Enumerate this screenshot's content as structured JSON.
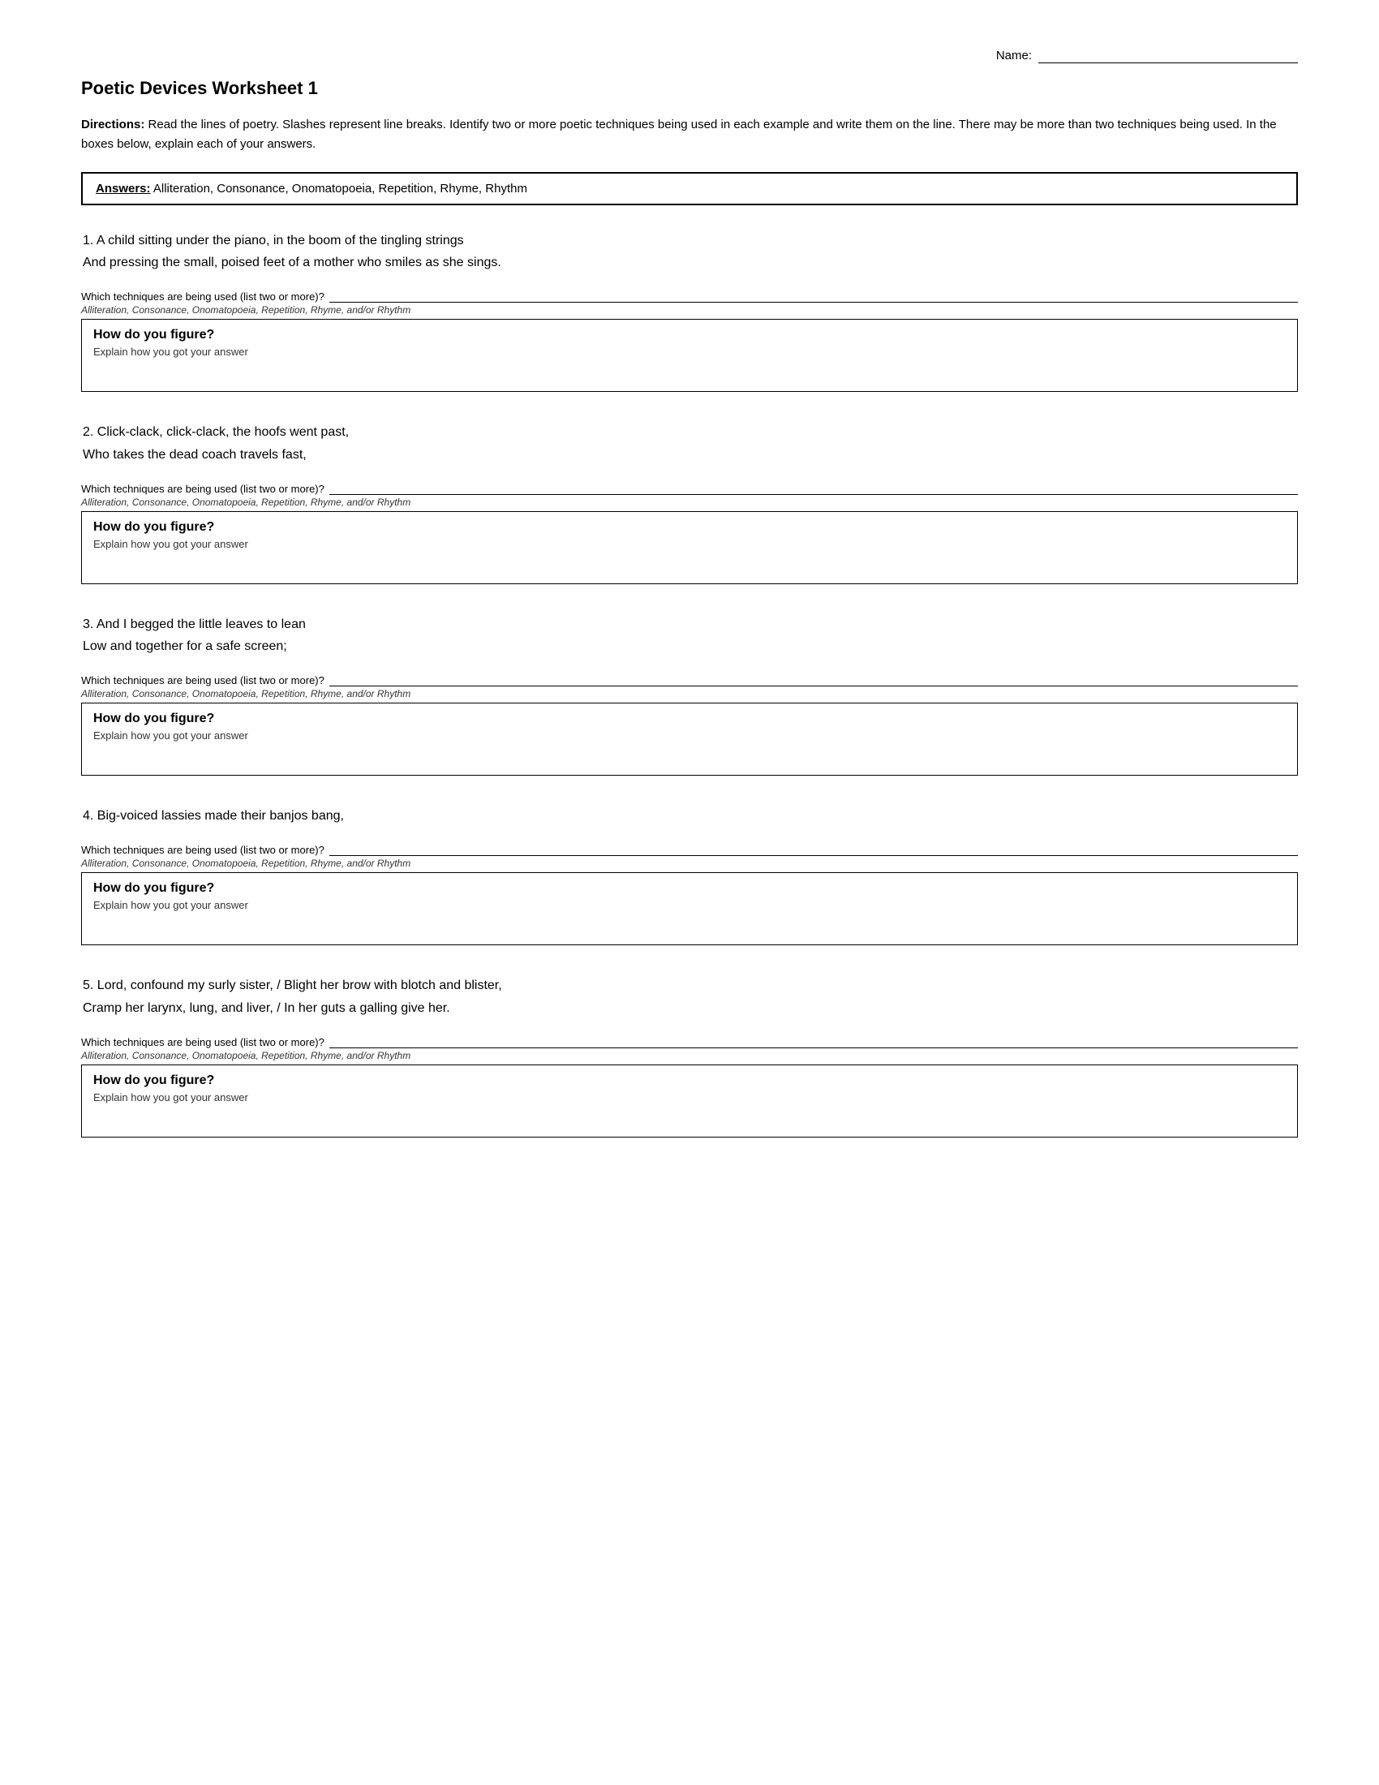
{
  "page": {
    "name_label": "Name:",
    "title": "Poetic Devices Worksheet 1",
    "directions_bold": "Directions:",
    "directions_text": " Read the lines of poetry. Slashes represent line breaks. Identify two or more poetic techniques being used in each example and write them on the line. There may be more than two techniques being used. In the boxes below, explain each of your answers.",
    "answers_bold": "Answers:",
    "answers_text": " Alliteration, Consonance, Onomatopoeia, Repetition, Rhyme, Rhythm",
    "which_techniques_label": "Which techniques are being used (list two or more)?",
    "hint_text": "Alliteration, Consonance, Onomatopoeia, Repetition, Rhyme, and/or Rhythm",
    "figure_title": "How do you figure?",
    "figure_subtitle": "Explain how you got your answer",
    "questions": [
      {
        "number": "1.",
        "poem": "A child sitting under the piano, in the boom of the tingling strings\nAnd pressing the small, poised feet of a mother who smiles as she sings."
      },
      {
        "number": "2.",
        "poem": "Click-clack, click-clack, the hoofs went past,\nWho takes the dead coach travels fast,"
      },
      {
        "number": "3.",
        "poem": "And I begged the little leaves to lean\nLow and together for a safe screen;"
      },
      {
        "number": "4.",
        "poem": "Big-voiced lassies made their banjos bang,"
      },
      {
        "number": "5.",
        "poem": "Lord, confound my surly sister, / Blight her brow with blotch and blister,\n Cramp her larynx, lung, and liver, / In her guts a galling give her."
      }
    ]
  }
}
